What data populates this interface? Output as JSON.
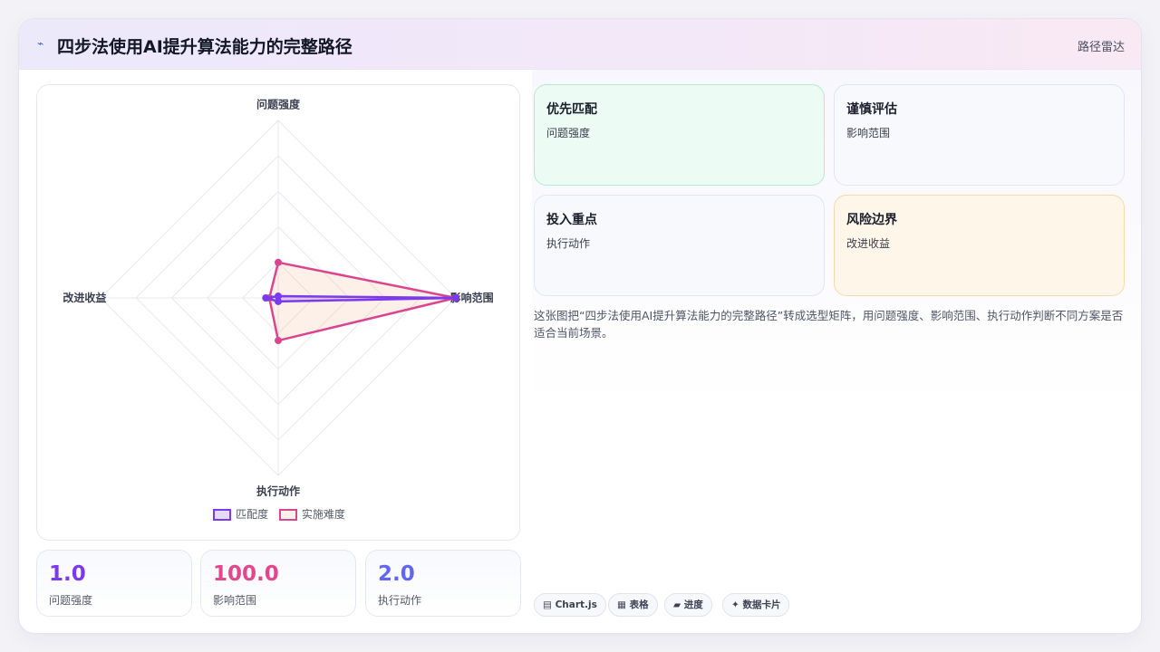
{
  "header": {
    "icon": "⌁",
    "title": "四步法使用AI提升算法能力的完整路径",
    "right_label": "路径雷达"
  },
  "chart_data": {
    "type": "radar",
    "axes": [
      "问题强度",
      "影响范围",
      "执行动作",
      "改进收益"
    ],
    "rmax": 100,
    "rings": 5,
    "series": [
      {
        "name": "匹配度",
        "values": [
          1,
          100,
          2,
          7
        ],
        "color": "#7c3aed",
        "fill": "rgba(124,58,237,0.18)"
      },
      {
        "name": "实施难度",
        "values": [
          20,
          100,
          24,
          5
        ],
        "color": "#d9468f",
        "fill": "rgba(245,170,130,0.18)"
      }
    ]
  },
  "stats": [
    {
      "value": "1.0",
      "label": "问题强度",
      "color": "#7c3aed"
    },
    {
      "value": "100.0",
      "label": "影响范围",
      "color": "#e0478c"
    },
    {
      "value": "2.0",
      "label": "执行动作",
      "color": "#6366f1"
    }
  ],
  "quadrants": [
    {
      "title": "优先匹配",
      "sub": "问题强度",
      "bg": "#ecfbf3",
      "border": "#b4ecd0"
    },
    {
      "title": "谨慎评估",
      "sub": "影响范围",
      "bg": "#f8f9fc",
      "border": "#e2e6f0"
    },
    {
      "title": "投入重点",
      "sub": "执行动作",
      "bg": "#f8f9fc",
      "border": "#e2e6f0"
    },
    {
      "title": "风险边界",
      "sub": "改进收益",
      "bg": "#fff6ea",
      "border": "#f7d9aa"
    }
  ],
  "description": "这张图把“四步法使用AI提升算法能力的完整路径”转成选型矩阵，用问题强度、影响范围、执行动作判断不同方案是否适合当前场景。",
  "chips": [
    "▤ Chart.js",
    "▦ 表格",
    "▰ 进度",
    "✦ 数据卡片"
  ]
}
